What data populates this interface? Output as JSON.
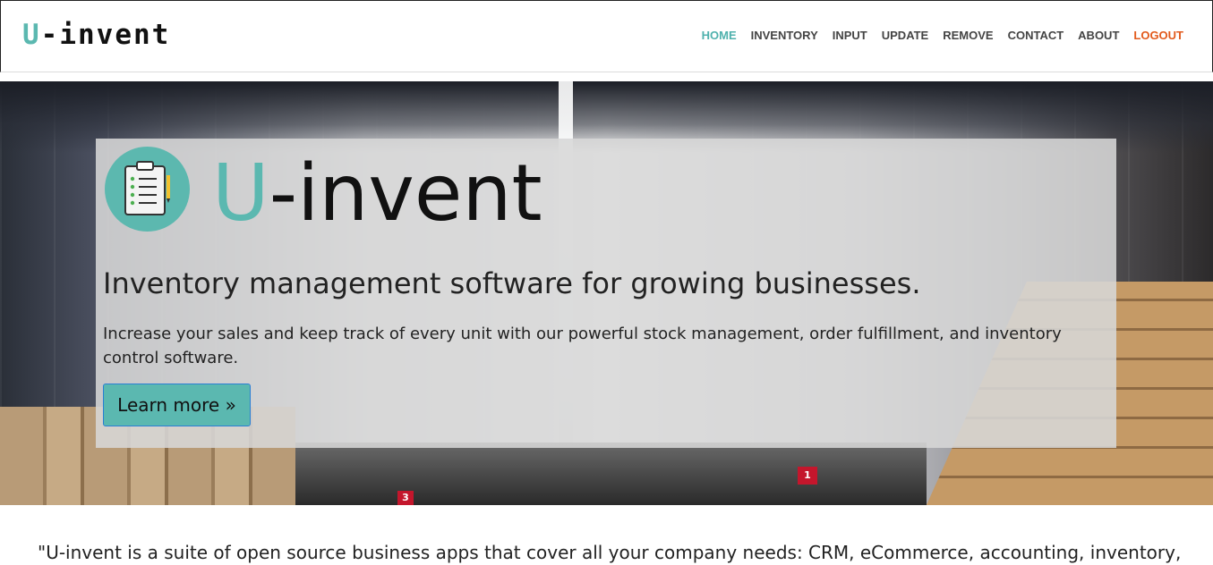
{
  "brand": {
    "prefix": "U",
    "suffix": "-invent"
  },
  "nav": [
    {
      "label": "HOME"
    },
    {
      "label": "INVENTORY"
    },
    {
      "label": "INPUT"
    },
    {
      "label": "UPDATE"
    },
    {
      "label": "REMOVE"
    },
    {
      "label": "CONTACT"
    },
    {
      "label": "ABOUT"
    },
    {
      "label": "LOGOUT"
    }
  ],
  "hero": {
    "title_prefix": "U",
    "title_suffix": "-invent",
    "subtitle": "Inventory management software for growing businesses.",
    "description": "Increase your sales and keep track of every unit with our powerful stock management, order fulfillment, and inventory control software.",
    "button_label": "Learn more »",
    "background_signs": [
      "3",
      "1"
    ]
  },
  "quote": "\"U-invent is a suite of open source business apps that cover all your company needs: CRM, eCommerce, accounting, inventory,",
  "colors": {
    "accent": "#5bb8b0",
    "nav_active": "#4fb1ad",
    "logout": "#e25a1c"
  }
}
